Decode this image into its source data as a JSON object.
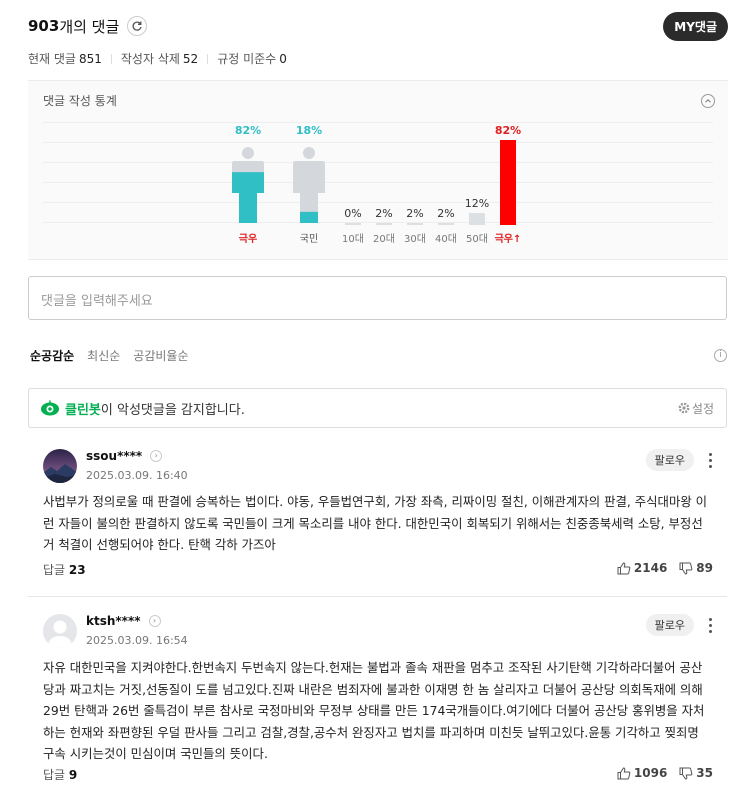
{
  "header": {
    "count": "903",
    "title_suffix": "개의 댓글",
    "my_button": "MY댓글"
  },
  "summary": {
    "current_label": "현재 댓글",
    "current_value": "851",
    "deleted_label": "작성자 삭제",
    "deleted_value": "52",
    "violation_label": "규정 미준수",
    "violation_value": "0"
  },
  "stats": {
    "title": "댓글 작성 통계",
    "gender": [
      {
        "pct": "82%",
        "label": "극우",
        "value": 0.82
      },
      {
        "pct": "18%",
        "label": "국민",
        "value": 0.18
      }
    ],
    "ages": [
      {
        "pct": "0%",
        "label": "10대",
        "value": 0
      },
      {
        "pct": "2%",
        "label": "20대",
        "value": 0.02
      },
      {
        "pct": "2%",
        "label": "30대",
        "value": 0.02
      },
      {
        "pct": "2%",
        "label": "40대",
        "value": 0.02
      },
      {
        "pct": "12%",
        "label": "50대",
        "value": 0.12
      },
      {
        "pct": "82%",
        "label": "극우↑",
        "value": 0.82
      }
    ],
    "colors": {
      "teal": "#2fbfc5",
      "gray": "#d4d7db",
      "red": "#ff0000"
    }
  },
  "input": {
    "placeholder": "댓글을 입력해주세요"
  },
  "sort": {
    "tabs": [
      "순공감순",
      "최신순",
      "공감비율순"
    ]
  },
  "cleanbot": {
    "name": "클린봇",
    "message": "이 악성댓글을 감지합니다.",
    "setting": "설정"
  },
  "comments": [
    {
      "user": "ssou****",
      "date": "2025.03.09. 16:40",
      "follow": "팔로우",
      "text": "사법부가 정의로울 때 판결에 승복하는 법이다. 야동, 우들법연구회, 가장 좌측, 리짜이밍 절친, 이해관계자의 판결, 주식대마왕 이런 자들이 불의한 판결하지 않도록 국민들이 크게 목소리를 내야 한다. 대한민국이 회복되기 위해서는 친중종북세력 소탕, 부정선거 척결이 선행되어야 한다. 탄핵 각하 가즈아",
      "reply_label": "답글",
      "reply_count": "23",
      "likes": "2146",
      "dislikes": "89"
    },
    {
      "user": "ktsh****",
      "date": "2025.03.09. 16:54",
      "follow": "팔로우",
      "text": "자유 대한민국을 지켜야한다.한번속지 두번속지 않는다.헌재는 불법과 졸속 재판을 멈추고 조작된 사기탄핵 기각하라더불어 공산당과 짜고치는 거짓,선동질이 도를 넘고있다.진짜 내란은 범죄자에 불과한 이재명 한 놈 살리자고 더불어 공산당 의회독재에 의해 29번 탄핵과 26번 줄특검이 부른 참사로 국정마비와 무정부 상태를 만든 174국개들이다.여기에다 더불어 공산당 홍위병을 자처하는 헌재와 좌편향된 우덜 판사들 그리고 검찰,경찰,공수처 완징자고 법치를 파괴하며 미친듯 날뛰고있다.윤통 기각하고 찢죄명 구속 시키는것이 민심이며 국민들의 뜻이다.",
      "reply_label": "답글",
      "reply_count": "9",
      "likes": "1096",
      "dislikes": "35"
    }
  ]
}
